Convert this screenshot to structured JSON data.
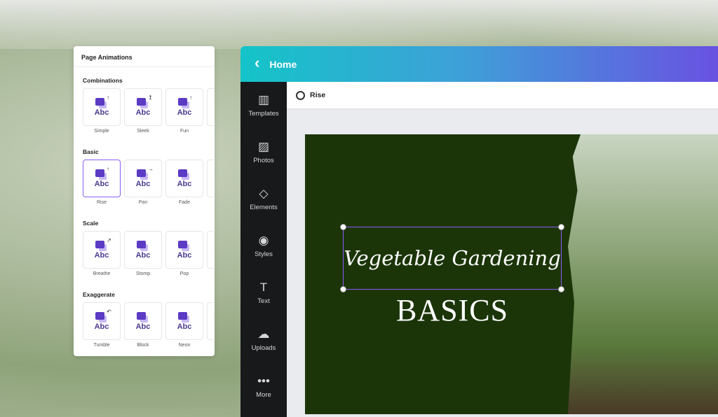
{
  "panel": {
    "title": "Page Animations",
    "sections": [
      {
        "name": "Combinations",
        "items": [
          "Simple",
          "Sleek",
          "Fun"
        ]
      },
      {
        "name": "Basic",
        "items": [
          "Rise",
          "Pan",
          "Fade"
        ]
      },
      {
        "name": "Scale",
        "items": [
          "Breathe",
          "Stomp",
          "Pop"
        ]
      },
      {
        "name": "Exaggerate",
        "items": [
          "Tumble",
          "Block",
          "Neon"
        ]
      }
    ],
    "tile_text": "Abc",
    "selected": "Rise"
  },
  "header": {
    "back": "‹",
    "title": "Home"
  },
  "sidebar": {
    "items": [
      {
        "label": "Templates",
        "icon": "▥"
      },
      {
        "label": "Photos",
        "icon": "▨"
      },
      {
        "label": "Elements",
        "icon": "◇"
      },
      {
        "label": "Styles",
        "icon": "◉"
      },
      {
        "label": "Text",
        "icon": "T"
      },
      {
        "label": "Uploads",
        "icon": "☁"
      },
      {
        "label": "More",
        "icon": "•••"
      }
    ]
  },
  "toolbar": {
    "animation": "Rise"
  },
  "design": {
    "script_title": "Vegetable Gardening",
    "subtitle": "BASICS",
    "bg_color": "#1b3509"
  }
}
